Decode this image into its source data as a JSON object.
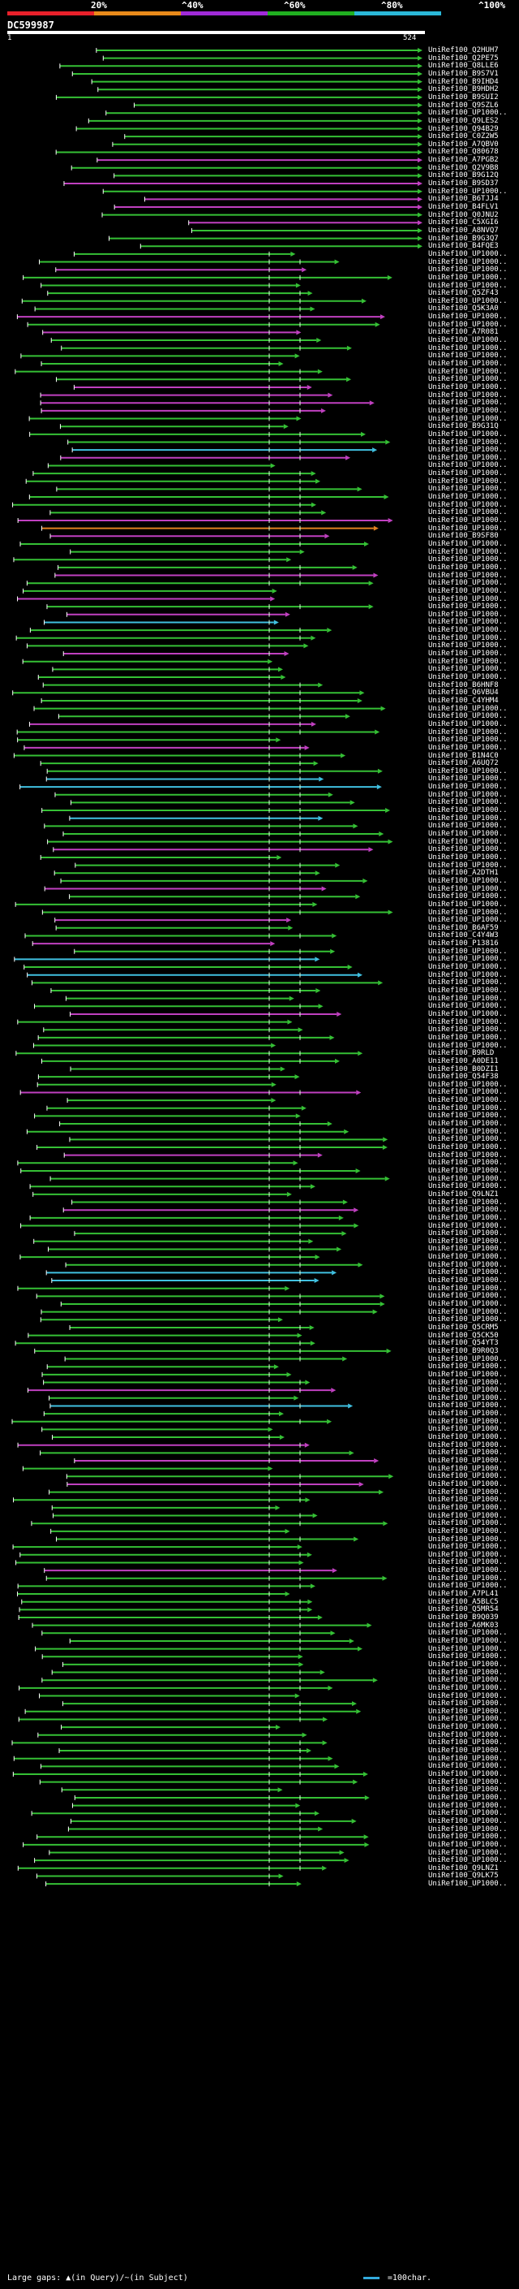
{
  "header": {
    "scale_ticks": [
      "20%",
      "^40%",
      "^60%",
      "^80%",
      "^100%"
    ],
    "colors": {
      "band_red": "#e8202a",
      "band_orange": "#e88a1a",
      "band_purple": "#a02ad8",
      "band_green": "#20b020",
      "band_cyan": "#2ab8d8",
      "hit_green": "#35c035",
      "hit_magenta": "#c040c0",
      "hit_cyan": "#40c0e0",
      "hit_orange": "#e08020",
      "query_bar": "#ffffff"
    }
  },
  "query": {
    "name": "DC599987",
    "start": "1",
    "end": "524"
  },
  "hits": [
    {
      "label": "UniRef100_Q2HUH7",
      "color": "green"
    },
    {
      "label": "UniRef100_Q2PE75",
      "color": "green"
    },
    {
      "label": "UniRef100_Q8LLE6",
      "color": "green"
    },
    {
      "label": "UniRef100_B9S7V1",
      "color": "green"
    },
    {
      "label": "UniRef100_B9IHD4",
      "color": "green"
    },
    {
      "label": "UniRef100_B9HDH2",
      "color": "green"
    },
    {
      "label": "UniRef100_B9SUI2",
      "color": "green"
    },
    {
      "label": "UniRef100_Q9SZL6",
      "color": "green"
    },
    {
      "label": "UniRef100_UP1000..",
      "color": "green"
    },
    {
      "label": "UniRef100_Q9LES2",
      "color": "green"
    },
    {
      "label": "UniRef100_Q94B29",
      "color": "green"
    },
    {
      "label": "UniRef100_C0Z2W5",
      "color": "green"
    },
    {
      "label": "UniRef100_A7QBV0",
      "color": "green"
    },
    {
      "label": "UniRef100_Q80678",
      "color": "green"
    },
    {
      "label": "UniRef100_A7PGB2",
      "color": "magenta"
    },
    {
      "label": "UniRef100_Q2V9B8",
      "color": "green"
    },
    {
      "label": "UniRef100_B9G12Q",
      "color": "green"
    },
    {
      "label": "UniRef100_B9SD37",
      "color": "magenta"
    },
    {
      "label": "UniRef100_UP1000..",
      "color": "green"
    },
    {
      "label": "UniRef100_B6TJJ4",
      "color": "magenta"
    },
    {
      "label": "UniRef100_B4FLV1",
      "color": "magenta"
    },
    {
      "label": "UniRef100_Q0JNU2",
      "color": "green"
    },
    {
      "label": "UniRef100_C5XGI6",
      "color": "magenta"
    },
    {
      "label": "UniRef100_A8NVQ7",
      "color": "green"
    },
    {
      "label": "UniRef100_B9G3Q7",
      "color": "green"
    },
    {
      "label": "UniRef100_B4FQE3",
      "color": "green"
    },
    {
      "label": "UniRef100_UP1000..",
      "color": "green"
    },
    {
      "label": "UniRef100_UP1000..",
      "color": "green"
    },
    {
      "label": "UniRef100_UP1000..",
      "color": "magenta"
    },
    {
      "label": "UniRef100_UP1000..",
      "color": "green"
    },
    {
      "label": "UniRef100_UP1000..",
      "color": "green"
    },
    {
      "label": "UniRef100_Q5ZF43",
      "color": "green"
    },
    {
      "label": "UniRef100_UP1000..",
      "color": "green"
    },
    {
      "label": "UniRef100_Q5K3A0",
      "color": "green"
    },
    {
      "label": "UniRef100_UP1000..",
      "color": "magenta"
    },
    {
      "label": "UniRef100_UP1000..",
      "color": "green"
    },
    {
      "label": "UniRef100_A7R081",
      "color": "magenta"
    },
    {
      "label": "UniRef100_UP1000..",
      "color": "green"
    },
    {
      "label": "UniRef100_UP1000..",
      "color": "green"
    },
    {
      "label": "UniRef100_UP1000..",
      "color": "green"
    },
    {
      "label": "UniRef100_UP1000..",
      "color": "green"
    },
    {
      "label": "UniRef100_UP1000..",
      "color": "green"
    },
    {
      "label": "UniRef100_UP1000..",
      "color": "green"
    },
    {
      "label": "UniRef100_UP1000..",
      "color": "magenta"
    },
    {
      "label": "UniRef100_UP1000..",
      "color": "magenta"
    },
    {
      "label": "UniRef100_UP1000..",
      "color": "magenta"
    },
    {
      "label": "UniRef100_UP1000..",
      "color": "magenta"
    },
    {
      "label": "UniRef100_UP1000..",
      "color": "green"
    },
    {
      "label": "UniRef100_B9G31Q",
      "color": "green"
    },
    {
      "label": "UniRef100_UP1000..",
      "color": "green"
    },
    {
      "label": "UniRef100_UP1000..",
      "color": "green"
    },
    {
      "label": "UniRef100_UP1000..",
      "color": "cyan"
    },
    {
      "label": "UniRef100_UP1000..",
      "color": "magenta"
    },
    {
      "label": "UniRef100_UP1000..",
      "color": "green"
    },
    {
      "label": "UniRef100_UP1000..",
      "color": "green"
    },
    {
      "label": "UniRef100_UP1000..",
      "color": "green"
    },
    {
      "label": "UniRef100_UP1000..",
      "color": "green"
    },
    {
      "label": "UniRef100_UP1000..",
      "color": "green"
    },
    {
      "label": "UniRef100_UP1000..",
      "color": "green"
    },
    {
      "label": "UniRef100_UP1000..",
      "color": "green"
    },
    {
      "label": "UniRef100_UP1000..",
      "color": "magenta"
    },
    {
      "label": "UniRef100_UP1000..",
      "color": "orange"
    },
    {
      "label": "UniRef100_B9SF80",
      "color": "magenta"
    },
    {
      "label": "UniRef100_UP1000..",
      "color": "green"
    },
    {
      "label": "UniRef100_UP1000..",
      "color": "green"
    },
    {
      "label": "UniRef100_UP1000..",
      "color": "green"
    },
    {
      "label": "UniRef100_UP1000..",
      "color": "green"
    },
    {
      "label": "UniRef100_UP1000..",
      "color": "magenta"
    },
    {
      "label": "UniRef100_UP1000..",
      "color": "green"
    },
    {
      "label": "UniRef100_UP1000..",
      "color": "green"
    },
    {
      "label": "UniRef100_UP1000..",
      "color": "magenta"
    },
    {
      "label": "UniRef100_UP1000..",
      "color": "green"
    },
    {
      "label": "UniRef100_UP1000..",
      "color": "magenta"
    },
    {
      "label": "UniRef100_UP1000..",
      "color": "cyan"
    },
    {
      "label": "UniRef100_UP1000..",
      "color": "green"
    },
    {
      "label": "UniRef100_UP1000..",
      "color": "green"
    },
    {
      "label": "UniRef100_UP1000..",
      "color": "green"
    },
    {
      "label": "UniRef100_UP1000..",
      "color": "magenta"
    },
    {
      "label": "UniRef100_UP1000..",
      "color": "green"
    },
    {
      "label": "UniRef100_UP1000..",
      "color": "green"
    },
    {
      "label": "UniRef100_UP1000..",
      "color": "green"
    },
    {
      "label": "UniRef100_B6HNF8",
      "color": "green"
    },
    {
      "label": "UniRef100_Q6VBU4",
      "color": "green"
    },
    {
      "label": "UniRef100_C4YHM4",
      "color": "green"
    },
    {
      "label": "UniRef100_UP1000..",
      "color": "green"
    },
    {
      "label": "UniRef100_UP1000..",
      "color": "green"
    },
    {
      "label": "UniRef100_UP1000..",
      "color": "magenta"
    },
    {
      "label": "UniRef100_UP1000..",
      "color": "green"
    },
    {
      "label": "UniRef100_UP1000..",
      "color": "green"
    },
    {
      "label": "UniRef100_UP1000..",
      "color": "magenta"
    },
    {
      "label": "UniRef100_B1N4C0",
      "color": "green"
    },
    {
      "label": "UniRef100_A6UQ72",
      "color": "green"
    },
    {
      "label": "UniRef100_UP1000..",
      "color": "green"
    },
    {
      "label": "UniRef100_UP1000..",
      "color": "cyan"
    },
    {
      "label": "UniRef100_UP1000..",
      "color": "cyan"
    },
    {
      "label": "UniRef100_UP1000..",
      "color": "green"
    },
    {
      "label": "UniRef100_UP1000..",
      "color": "green"
    },
    {
      "label": "UniRef100_UP1000..",
      "color": "green"
    },
    {
      "label": "UniRef100_UP1000..",
      "color": "cyan"
    },
    {
      "label": "UniRef100_UP1000..",
      "color": "green"
    },
    {
      "label": "UniRef100_UP1000..",
      "color": "green"
    },
    {
      "label": "UniRef100_UP1000..",
      "color": "green"
    },
    {
      "label": "UniRef100_UP1000..",
      "color": "magenta"
    },
    {
      "label": "UniRef100_UP1000..",
      "color": "green"
    },
    {
      "label": "UniRef100_UP1000..",
      "color": "green"
    },
    {
      "label": "UniRef100_A2DTH1",
      "color": "green"
    },
    {
      "label": "UniRef100_UP1000..",
      "color": "green"
    },
    {
      "label": "UniRef100_UP1000..",
      "color": "magenta"
    },
    {
      "label": "UniRef100_UP1000..",
      "color": "green"
    },
    {
      "label": "UniRef100_UP1000..",
      "color": "green"
    },
    {
      "label": "UniRef100_UP1000..",
      "color": "green"
    },
    {
      "label": "UniRef100_UP1000..",
      "color": "magenta"
    },
    {
      "label": "UniRef100_B6AF59",
      "color": "green"
    },
    {
      "label": "UniRef100_C4Y4W3",
      "color": "green"
    },
    {
      "label": "UniRef100_P13816",
      "color": "magenta"
    },
    {
      "label": "UniRef100_UP1000..",
      "color": "green"
    },
    {
      "label": "UniRef100_UP1000..",
      "color": "cyan"
    },
    {
      "label": "UniRef100_UP1000..",
      "color": "green"
    },
    {
      "label": "UniRef100_UP1000..",
      "color": "cyan"
    },
    {
      "label": "UniRef100_UP1000..",
      "color": "green"
    },
    {
      "label": "UniRef100_UP1000..",
      "color": "green"
    },
    {
      "label": "UniRef100_UP1000..",
      "color": "green"
    },
    {
      "label": "UniRef100_UP1000..",
      "color": "green"
    },
    {
      "label": "UniRef100_UP1000..",
      "color": "magenta"
    },
    {
      "label": "UniRef100_UP1000..",
      "color": "green"
    },
    {
      "label": "UniRef100_UP1000..",
      "color": "green"
    },
    {
      "label": "UniRef100_UP1000..",
      "color": "green"
    },
    {
      "label": "UniRef100_UP1000..",
      "color": "green"
    },
    {
      "label": "UniRef100_B9RLD",
      "color": "green"
    },
    {
      "label": "UniRef100_A0DE11",
      "color": "green"
    },
    {
      "label": "UniRef100_B0DZI1",
      "color": "green"
    },
    {
      "label": "UniRef100_Q54F38",
      "color": "green"
    },
    {
      "label": "UniRef100_UP1000..",
      "color": "green"
    },
    {
      "label": "UniRef100_UP1000..",
      "color": "magenta"
    },
    {
      "label": "UniRef100_UP1000..",
      "color": "green"
    },
    {
      "label": "UniRef100_UP1000..",
      "color": "green"
    },
    {
      "label": "UniRef100_UP1000..",
      "color": "green"
    },
    {
      "label": "UniRef100_UP1000..",
      "color": "green"
    },
    {
      "label": "UniRef100_UP1000..",
      "color": "green"
    },
    {
      "label": "UniRef100_UP1000..",
      "color": "green"
    },
    {
      "label": "UniRef100_UP1000..",
      "color": "green"
    },
    {
      "label": "UniRef100_UP1000..",
      "color": "magenta"
    },
    {
      "label": "UniRef100_UP1000..",
      "color": "green"
    },
    {
      "label": "UniRef100_UP1000..",
      "color": "green"
    },
    {
      "label": "UniRef100_UP1000..",
      "color": "green"
    },
    {
      "label": "UniRef100_UP1000..",
      "color": "green"
    },
    {
      "label": "UniRef100_Q9LNZ1",
      "color": "green"
    },
    {
      "label": "UniRef100_UP1000..",
      "color": "green"
    },
    {
      "label": "UniRef100_UP1000..",
      "color": "magenta"
    },
    {
      "label": "UniRef100_UP1000..",
      "color": "green"
    },
    {
      "label": "UniRef100_UP1000..",
      "color": "green"
    },
    {
      "label": "UniRef100_UP1000..",
      "color": "green"
    },
    {
      "label": "UniRef100_UP1000..",
      "color": "green"
    },
    {
      "label": "UniRef100_UP1000..",
      "color": "green"
    },
    {
      "label": "UniRef100_UP1000..",
      "color": "green"
    },
    {
      "label": "UniRef100_UP1000..",
      "color": "green"
    },
    {
      "label": "UniRef100_UP1000..",
      "color": "cyan"
    },
    {
      "label": "UniRef100_UP1000..",
      "color": "cyan"
    },
    {
      "label": "UniRef100_UP1000..",
      "color": "green"
    },
    {
      "label": "UniRef100_UP1000..",
      "color": "green"
    },
    {
      "label": "UniRef100_UP1000..",
      "color": "green"
    },
    {
      "label": "UniRef100_UP1000..",
      "color": "green"
    },
    {
      "label": "UniRef100_UP1000..",
      "color": "green"
    },
    {
      "label": "UniRef100_Q5CRM5",
      "color": "green"
    },
    {
      "label": "UniRef100_Q5CK50",
      "color": "green"
    },
    {
      "label": "UniRef100_Q54YT3",
      "color": "green"
    },
    {
      "label": "UniRef100_B9R0Q3",
      "color": "green"
    },
    {
      "label": "UniRef100_UP1000..",
      "color": "green"
    },
    {
      "label": "UniRef100_UP1000..",
      "color": "green"
    },
    {
      "label": "UniRef100_UP1000..",
      "color": "green"
    },
    {
      "label": "UniRef100_UP1000..",
      "color": "green"
    },
    {
      "label": "UniRef100_UP1000..",
      "color": "magenta"
    },
    {
      "label": "UniRef100_UP1000..",
      "color": "green"
    },
    {
      "label": "UniRef100_UP1000..",
      "color": "cyan"
    },
    {
      "label": "UniRef100_UP1000..",
      "color": "green"
    },
    {
      "label": "UniRef100_UP1000..",
      "color": "green"
    },
    {
      "label": "UniRef100_UP1000..",
      "color": "green"
    },
    {
      "label": "UniRef100_UP1000..",
      "color": "green"
    },
    {
      "label": "UniRef100_UP1000..",
      "color": "magenta"
    },
    {
      "label": "UniRef100_UP1000..",
      "color": "green"
    },
    {
      "label": "UniRef100_UP1000..",
      "color": "magenta"
    },
    {
      "label": "UniRef100_UP1000..",
      "color": "green"
    },
    {
      "label": "UniRef100_UP1000..",
      "color": "green"
    },
    {
      "label": "UniRef100_UP1000..",
      "color": "magenta"
    },
    {
      "label": "UniRef100_UP1000..",
      "color": "green"
    },
    {
      "label": "UniRef100_UP1000..",
      "color": "green"
    },
    {
      "label": "UniRef100_UP1000..",
      "color": "green"
    },
    {
      "label": "UniRef100_UP1000..",
      "color": "green"
    },
    {
      "label": "UniRef100_UP1000..",
      "color": "green"
    },
    {
      "label": "UniRef100_UP1000..",
      "color": "green"
    },
    {
      "label": "UniRef100_UP1000..",
      "color": "green"
    },
    {
      "label": "UniRef100_UP1000..",
      "color": "green"
    },
    {
      "label": "UniRef100_UP1000..",
      "color": "green"
    },
    {
      "label": "UniRef100_UP1000..",
      "color": "green"
    },
    {
      "label": "UniRef100_UP1000..",
      "color": "magenta"
    },
    {
      "label": "UniRef100_UP1000..",
      "color": "green"
    },
    {
      "label": "UniRef100_UP1000..",
      "color": "green"
    },
    {
      "label": "UniRef100_A7PL41",
      "color": "green"
    },
    {
      "label": "UniRef100_A5BLC5",
      "color": "green"
    },
    {
      "label": "UniRef100_Q5MR54",
      "color": "green"
    },
    {
      "label": "UniRef100_B9Q039",
      "color": "green"
    },
    {
      "label": "UniRef100_A6MK03",
      "color": "green"
    },
    {
      "label": "UniRef100_UP1000..",
      "color": "green"
    },
    {
      "label": "UniRef100_UP1000..",
      "color": "green"
    },
    {
      "label": "UniRef100_UP1000..",
      "color": "green"
    },
    {
      "label": "UniRef100_UP1000..",
      "color": "green"
    },
    {
      "label": "UniRef100_UP1000..",
      "color": "green"
    },
    {
      "label": "UniRef100_UP1000..",
      "color": "green"
    },
    {
      "label": "UniRef100_UP1000..",
      "color": "green"
    },
    {
      "label": "UniRef100_UP1000..",
      "color": "green"
    },
    {
      "label": "UniRef100_UP1000..",
      "color": "green"
    },
    {
      "label": "UniRef100_UP1000..",
      "color": "green"
    },
    {
      "label": "UniRef100_UP1000..",
      "color": "green"
    },
    {
      "label": "UniRef100_UP1000..",
      "color": "green"
    },
    {
      "label": "UniRef100_UP1000..",
      "color": "green"
    },
    {
      "label": "UniRef100_UP1000..",
      "color": "green"
    },
    {
      "label": "UniRef100_UP1000..",
      "color": "green"
    },
    {
      "label": "UniRef100_UP1000..",
      "color": "green"
    },
    {
      "label": "UniRef100_UP1000..",
      "color": "green"
    },
    {
      "label": "UniRef100_UP1000..",
      "color": "green"
    },
    {
      "label": "UniRef100_UP1000..",
      "color": "green"
    },
    {
      "label": "UniRef100_UP1000..",
      "color": "green"
    },
    {
      "label": "UniRef100_UP1000..",
      "color": "green"
    },
    {
      "label": "UniRef100_UP1000..",
      "color": "green"
    },
    {
      "label": "UniRef100_UP1000..",
      "color": "green"
    },
    {
      "label": "UniRef100_UP1000..",
      "color": "green"
    },
    {
      "label": "UniRef100_UP1000..",
      "color": "green"
    },
    {
      "label": "UniRef100_UP1000..",
      "color": "green"
    },
    {
      "label": "UniRef100_UP1000..",
      "color": "green"
    },
    {
      "label": "UniRef100_UP1000..",
      "color": "green"
    },
    {
      "label": "UniRef100_UP1000..",
      "color": "green"
    },
    {
      "label": "UniRef100_UP1000..",
      "color": "green"
    },
    {
      "label": "UniRef100_Q9LNZ1",
      "color": "green"
    },
    {
      "label": "UniRef100_Q9LK75",
      "color": "green"
    },
    {
      "label": "UniRef100_UP1000..",
      "color": "green"
    }
  ],
  "footer": {
    "gap_legend": "Large gaps: ▲(in Query)/~(in Subject)",
    "scale_legend": "=100char."
  }
}
